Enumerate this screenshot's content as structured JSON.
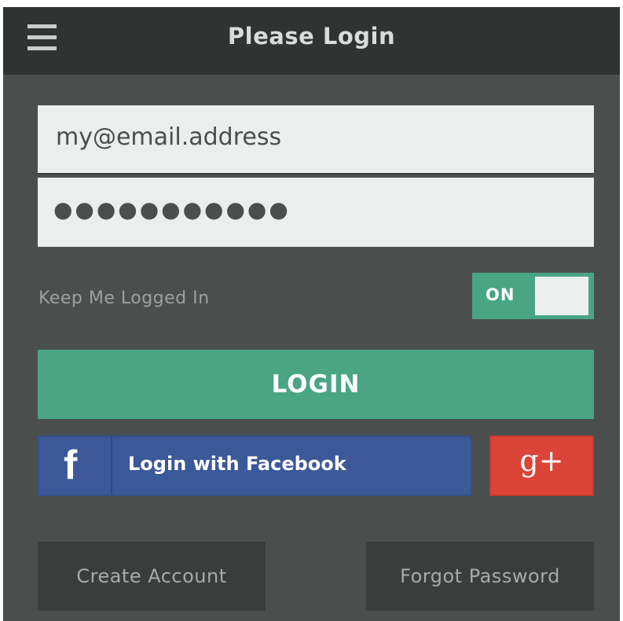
{
  "header": {
    "title": "Please Login",
    "menu_icon": "hamburger-menu-icon"
  },
  "form": {
    "email_value": "my@email.address",
    "password_value": "●●●●●●●●●●●"
  },
  "keep_logged_in": {
    "label": "Keep Me Logged In",
    "toggle_label": "ON",
    "state": true
  },
  "buttons": {
    "login": "LOGIN",
    "facebook_icon": "f",
    "facebook_label": "Login with Facebook",
    "google_plus_icon": "g+",
    "create_account": "Create Account",
    "forgot_password": "Forgot Password"
  },
  "colors": {
    "background": "#4a4f4e",
    "header": "#2f3332",
    "accent_green": "#4aa584",
    "facebook_blue": "#3b5898",
    "google_red": "#db4437",
    "secondary_button": "#393d3c"
  }
}
